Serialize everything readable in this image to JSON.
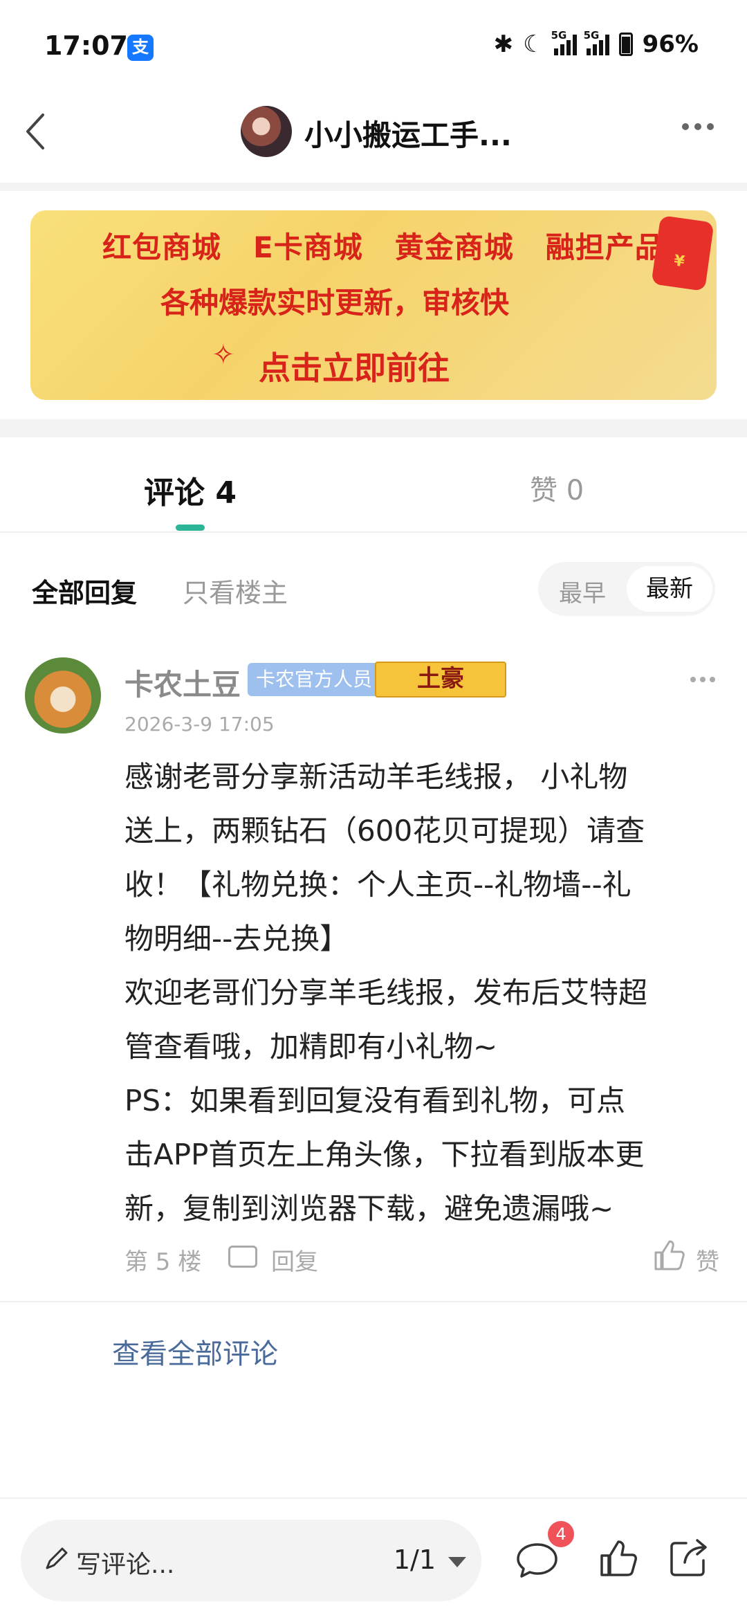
{
  "status_bar": {
    "time": "17:07",
    "app_icon_label": "支",
    "network1": "5G",
    "network2": "5G",
    "battery": "96%"
  },
  "header": {
    "title": "小小搬运工手..."
  },
  "banner": {
    "items": [
      "红包商城",
      "E卡商城",
      "黄金商城",
      "融担产品"
    ],
    "subtitle": "各种爆款实时更新，审核快",
    "cta": "点击立即前往"
  },
  "tabs": {
    "comments": "评论 4",
    "likes": "赞 0"
  },
  "filter": {
    "all": "全部回复",
    "op_only": "只看楼主",
    "earliest": "最早",
    "latest": "最新"
  },
  "comment": {
    "username": "卡农土豆",
    "badge_official": "卡农官方人员",
    "badge_rich": "土豪",
    "time": "2026-3-9 17:05",
    "lines": [
      "感谢老哥分享新活动羊毛线报， 小礼物",
      "送上，两颗钻石（600花贝可提现）请查",
      "收！【礼物兑换：个人主页--礼物墙--礼",
      "物明细--去兑换】",
      "欢迎老哥们分享羊毛线报，发布后艾特超",
      "管查看哦，加精即有小礼物~",
      "PS：如果看到回复没有看到礼物，可点",
      "击APP首页左上角头像，下拉看到版本更",
      "新，复制到浏览器下载，避免遗漏哦~"
    ],
    "floor": "第 5 楼",
    "reply": "回复",
    "like": "赞"
  },
  "view_all": "查看全部评论",
  "bottom_bar": {
    "placeholder": "写评论...",
    "page": "1/1",
    "comment_count": "4"
  }
}
